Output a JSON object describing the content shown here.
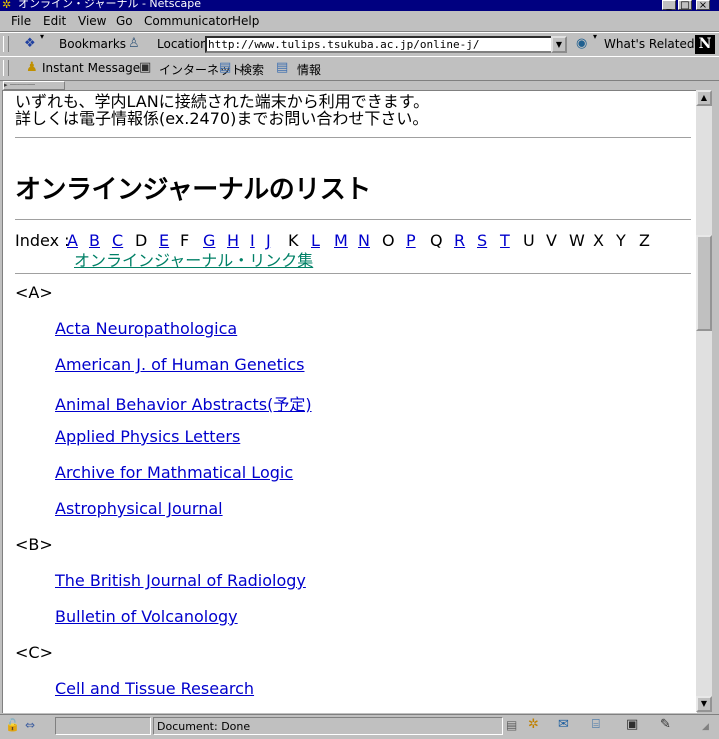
{
  "window": {
    "title": "オンライン・ジャーナル - Netscape"
  },
  "menu": [
    "File",
    "Edit",
    "View",
    "Go",
    "Communicator",
    "Help"
  ],
  "nav_toolbar": {
    "bookmarks_label": "Bookmarks",
    "location_label": "Location:",
    "location_value": "http://www.tulips.tsukuba.ac.jp/online-j/",
    "whats_related_label": "What's Related"
  },
  "personal_toolbar": {
    "items": [
      "Instant Message",
      "インターネット",
      "検索",
      "情報"
    ]
  },
  "page": {
    "intro_line1": "いずれも、学内LANに接続された端末から利用できます。",
    "intro_line2": "詳しくは電子情報係(ex.2470)までお問い合わせ下さい。",
    "heading": "オンラインジャーナルのリスト",
    "index_label": "Index :",
    "index_letters": [
      {
        "letter": "A",
        "link": true
      },
      {
        "letter": "B",
        "link": true
      },
      {
        "letter": "C",
        "link": true
      },
      {
        "letter": "D",
        "link": false
      },
      {
        "letter": "E",
        "link": true
      },
      {
        "letter": "F",
        "link": false
      },
      {
        "letter": "G",
        "link": true
      },
      {
        "letter": "H",
        "link": true
      },
      {
        "letter": "I",
        "link": true
      },
      {
        "letter": "J",
        "link": true
      },
      {
        "letter": "K",
        "link": false
      },
      {
        "letter": "L",
        "link": true
      },
      {
        "letter": "M",
        "link": true
      },
      {
        "letter": "N",
        "link": true
      },
      {
        "letter": "O",
        "link": false
      },
      {
        "letter": "P",
        "link": true
      },
      {
        "letter": "Q",
        "link": false
      },
      {
        "letter": "R",
        "link": true
      },
      {
        "letter": "S",
        "link": true
      },
      {
        "letter": "T",
        "link": true
      },
      {
        "letter": "U",
        "link": false
      },
      {
        "letter": "V",
        "link": false
      },
      {
        "letter": "W",
        "link": false
      },
      {
        "letter": "X",
        "link": false
      },
      {
        "letter": "Y",
        "link": false
      },
      {
        "letter": "Z",
        "link": false
      }
    ],
    "link_collection": "オンラインジャーナル・リンク集",
    "sections": [
      {
        "label": "<A>",
        "items": [
          "Acta Neuropathologica",
          "American J. of Human Genetics",
          "Animal Behavior Abstracts(予定)",
          "Applied Physics Letters",
          "Archive for Mathmatical Logic",
          "Astrophysical Journal"
        ]
      },
      {
        "label": "<B>",
        "items": [
          "The British Journal of Radiology",
          "Bulletin of Volcanology"
        ]
      },
      {
        "label": "<C>",
        "items": [
          "Cell and Tissue Research"
        ]
      }
    ]
  },
  "status": {
    "text": "Document: Done"
  }
}
